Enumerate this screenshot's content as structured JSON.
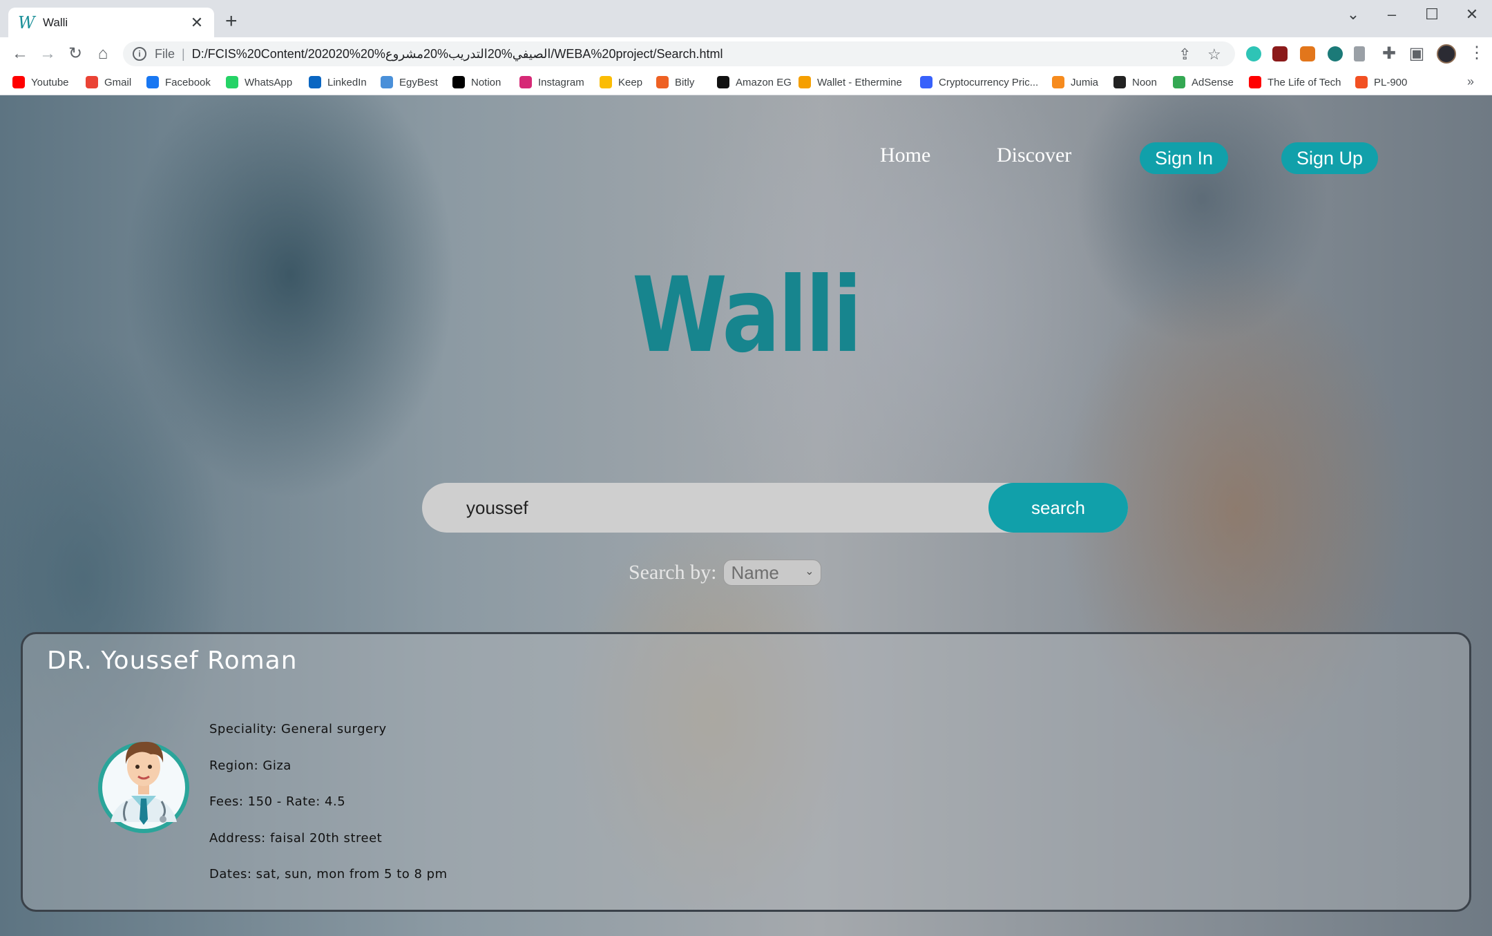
{
  "browser": {
    "tab_title": "Walli",
    "tab_favicon": "W",
    "url_scheme": "File",
    "url": "D:/FCIS%20Content/202020%الصيفي%20التدريب%20مشروع%20/WEBA%20project/Search.html"
  },
  "bookmarks": [
    {
      "label": "Youtube",
      "color": "#ff0000"
    },
    {
      "label": "Gmail",
      "color": "#ea4335"
    },
    {
      "label": "Facebook",
      "color": "#1877f2"
    },
    {
      "label": "WhatsApp",
      "color": "#25d366"
    },
    {
      "label": "LinkedIn",
      "color": "#0a66c2"
    },
    {
      "label": "EgyBest",
      "color": "#4a90d9"
    },
    {
      "label": "Notion",
      "color": "#000000"
    },
    {
      "label": "Instagram",
      "color": "#d62976"
    },
    {
      "label": "Keep",
      "color": "#fbbc04"
    },
    {
      "label": "Bitly",
      "color": "#ee6123"
    },
    {
      "label": "Amazon EG",
      "color": "#111111"
    },
    {
      "label": "Wallet - Ethermine",
      "color": "#f59f00"
    },
    {
      "label": "Cryptocurrency Pric...",
      "color": "#3861fb"
    },
    {
      "label": "Jumia",
      "color": "#f68b1e"
    },
    {
      "label": "Noon",
      "color": "#222222"
    },
    {
      "label": "AdSense",
      "color": "#34a853"
    },
    {
      "label": "The Life of Tech",
      "color": "#ff0000"
    },
    {
      "label": "PL-900",
      "color": "#f25022"
    }
  ],
  "nav": {
    "home": "Home",
    "discover": "Discover",
    "sign_in": "Sign In",
    "sign_up": "Sign Up"
  },
  "logo_text": "Walli",
  "search": {
    "value": "youssef",
    "button": "search",
    "by_label": "Search by:",
    "by_selected": "Name"
  },
  "result": {
    "name": "DR. Youssef Roman",
    "speciality": "Speciality: General surgery",
    "region": "Region: Giza",
    "fees": "Fees: 150 - Rate: 4.5",
    "address": "Address: faisal 20th street",
    "dates": "Dates: sat, sun, mon from 5 to 8 pm"
  },
  "colors": {
    "accent": "#11a0aa",
    "logo": "#17858e"
  }
}
